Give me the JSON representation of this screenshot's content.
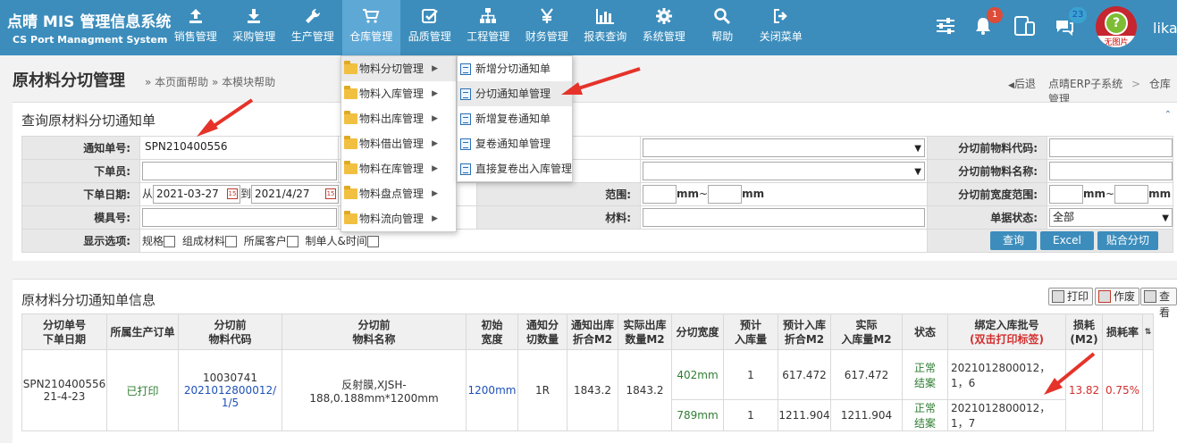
{
  "header": {
    "app_title": "点晴 MIS 管理信息系统",
    "app_subtitle": "CS Port Managment System",
    "nav": [
      {
        "label": "销售管理",
        "icon": "upload-icon"
      },
      {
        "label": "采购管理",
        "icon": "download-icon"
      },
      {
        "label": "生产管理",
        "icon": "wrench-icon"
      },
      {
        "label": "仓库管理",
        "icon": "cart-icon"
      },
      {
        "label": "品质管理",
        "icon": "check-square-icon"
      },
      {
        "label": "工程管理",
        "icon": "sitemap-icon"
      },
      {
        "label": "财务管理",
        "icon": "yen-icon"
      },
      {
        "label": "报表查询",
        "icon": "bar-chart-icon"
      },
      {
        "label": "系统管理",
        "icon": "gear-icon"
      },
      {
        "label": "帮助",
        "icon": "search-icon"
      },
      {
        "label": "关闭菜单",
        "icon": "sign-out-icon"
      }
    ],
    "bell_count": "1",
    "chat_count": "23",
    "avatar_text": "无图片",
    "username": "lika"
  },
  "page": {
    "title": "原材料分切管理",
    "help_page": "» 本页面帮助",
    "help_module": "» 本模块帮助",
    "back": "后退",
    "breadcrumb_1": "点晴ERP子系统",
    "breadcrumb_sep": ">",
    "breadcrumb_2": "仓库管理"
  },
  "menu_level1": [
    {
      "label": "物料分切管理"
    },
    {
      "label": "物料入库管理"
    },
    {
      "label": "物料出库管理"
    },
    {
      "label": "物料借出管理"
    },
    {
      "label": "物料在库管理"
    },
    {
      "label": "物料盘点管理"
    },
    {
      "label": "物料流向管理"
    }
  ],
  "menu_level2": [
    {
      "label": "新增分切通知单"
    },
    {
      "label": "分切通知单管理"
    },
    {
      "label": "新增复卷通知单"
    },
    {
      "label": "复卷通知单管理"
    },
    {
      "label": "直接复卷出入库管理"
    }
  ],
  "query": {
    "title": "查询原材料分切通知单",
    "notice_no_label": "通知单号:",
    "notice_no_value": "SPN210400556",
    "issuer_label": "下单员:",
    "date_label": "下单日期:",
    "date_from_prefix": "从",
    "date_from": "2021-03-27",
    "date_to_prefix": "到",
    "date_to": "2021/4/27",
    "mold_label": "模具号:",
    "display_label": "显示选项:",
    "opt_spec": "规格",
    "opt_composition": "组成材料",
    "opt_customer": "所属客户",
    "opt_maker": "制单人&时间",
    "range_label_partial": "范围:",
    "mm1": "mm",
    "tilde1": "~",
    "mm2": "mm",
    "material_label_partial": "材料:",
    "pre_code_label": "分切前物料代码:",
    "pre_name_label": "分切前物料名称:",
    "pre_width_label": "分切前宽度范围:",
    "mm3": "mm",
    "tilde2": "~",
    "mm4": "mm",
    "status_label": "单据状态:",
    "status_value": "全部",
    "btn_query": "查询",
    "btn_excel": "Excel",
    "btn_paste": "贴合分切"
  },
  "results": {
    "title": "原材料分切通知单信息",
    "btn_print": "打印",
    "btn_void": "作废",
    "btn_view": "查看",
    "headers": [
      "分切单号\n下单日期",
      "所属生产订单",
      "分切前\n物料代码",
      "分切前\n物料名称",
      "初始\n宽度",
      "通知分\n切数量",
      "通知出库\n折合M2",
      "实际出库\n数量M2",
      "分切宽度",
      "预计\n入库量",
      "预计入库\n折合M2",
      "实际\n入库量M2",
      "状态",
      "绑定入库批号",
      "损耗\n(M2)",
      "损耗率"
    ],
    "header_bind_sub": "(双击打印标签)",
    "row": {
      "order_no": "SPN210400556",
      "order_date": "21-4-23",
      "status_print": "已打印",
      "code_line1": "10030741",
      "code_line2": "2021012800012/1/5",
      "name": "反射膜,XJSH-188,0.188mm*1200mm",
      "width": "1200mm",
      "qty": "1R",
      "out_m2": "1843.2",
      "actual_out": "1843.2",
      "loss": "13.82",
      "loss_rate": "0.75%",
      "subs": [
        {
          "cut_width": "402mm",
          "est_qty": "1",
          "est_m2": "617.472",
          "act_m2": "617.472",
          "state": "正常结案",
          "batch": "2021012800012，1，6"
        },
        {
          "cut_width": "789mm",
          "est_qty": "1",
          "est_m2": "1211.904",
          "act_m2": "1211.904",
          "state": "正常结案",
          "batch": "2021012800012，1，7"
        }
      ]
    }
  },
  "colors": {
    "header_bg": "#3c8dbc",
    "nav_active": "#5ea8d6",
    "arrow_red": "#e5332a"
  }
}
